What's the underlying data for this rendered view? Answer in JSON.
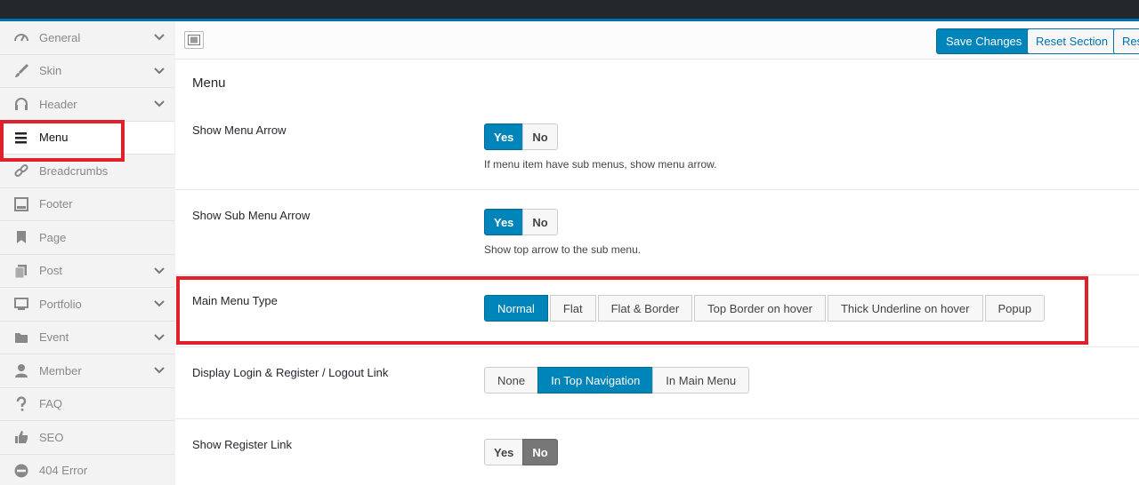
{
  "sidebar": {
    "items": [
      {
        "label": "General",
        "icon": "dashboard-gauge-icon",
        "has_children": true,
        "active": false
      },
      {
        "label": "Skin",
        "icon": "brush-icon",
        "has_children": true,
        "active": false
      },
      {
        "label": "Header",
        "icon": "headphones-icon",
        "has_children": true,
        "active": false
      },
      {
        "label": "Menu",
        "icon": "menu-bars-icon",
        "has_children": false,
        "active": true
      },
      {
        "label": "Breadcrumbs",
        "icon": "link-icon",
        "has_children": false,
        "active": false
      },
      {
        "label": "Footer",
        "icon": "footer-layout-icon",
        "has_children": false,
        "active": false
      },
      {
        "label": "Page",
        "icon": "bookmark-icon",
        "has_children": false,
        "active": false
      },
      {
        "label": "Post",
        "icon": "copy-icon",
        "has_children": true,
        "active": false
      },
      {
        "label": "Portfolio",
        "icon": "monitor-icon",
        "has_children": true,
        "active": false
      },
      {
        "label": "Event",
        "icon": "folder-icon",
        "has_children": true,
        "active": false
      },
      {
        "label": "Member",
        "icon": "user-icon",
        "has_children": true,
        "active": false
      },
      {
        "label": "FAQ",
        "icon": "question-icon",
        "has_children": false,
        "active": false
      },
      {
        "label": "SEO",
        "icon": "thumbs-up-icon",
        "has_children": false,
        "active": false
      },
      {
        "label": "404 Error",
        "icon": "no-entry-icon",
        "has_children": false,
        "active": false
      }
    ]
  },
  "toolbar": {
    "save_label": "Save Changes",
    "reset_section_label": "Reset Section",
    "reset_all_label": "Res"
  },
  "section": {
    "title": "Menu"
  },
  "options": [
    {
      "label": "Show Menu Arrow",
      "buttons": [
        "Yes",
        "No"
      ],
      "selected": "Yes",
      "description": "If menu item have sub menus, show menu arrow."
    },
    {
      "label": "Show Sub Menu Arrow",
      "buttons": [
        "Yes",
        "No"
      ],
      "selected": "Yes",
      "description": "Show top arrow to the sub menu."
    },
    {
      "label": "Main Menu Type",
      "buttons": [
        "Normal",
        "Flat",
        "Flat & Border",
        "Top Border on hover",
        "Thick Underline on hover",
        "Popup"
      ],
      "selected": "Normal",
      "description": ""
    },
    {
      "label": "Display Login & Register / Logout Link",
      "buttons": [
        "None",
        "In Top Navigation",
        "In Main Menu"
      ],
      "selected": "In Top Navigation",
      "description": ""
    },
    {
      "label": "Show Register Link",
      "buttons": [
        "Yes",
        "No"
      ],
      "selected": "No",
      "description": ""
    }
  ],
  "colors": {
    "accent": "#0085ba",
    "highlight": "#e0202a",
    "admin_bar": "#23282d"
  }
}
